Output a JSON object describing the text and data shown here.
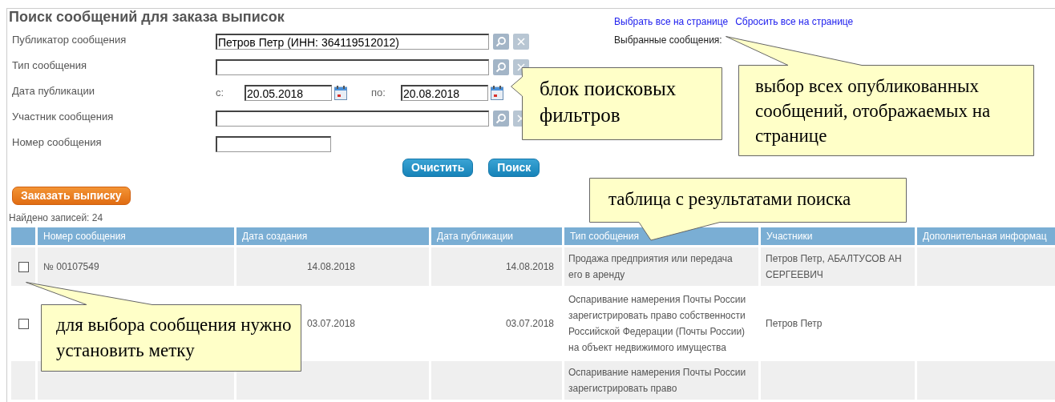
{
  "title": "Поиск сообщений для заказа выписок",
  "filters": [
    {
      "kind": "lookup",
      "label": "Публикатор сообщения",
      "value": "Петров Петр (ИНН: 364119512012)"
    },
    {
      "kind": "lookup",
      "label": "Тип сообщения"
    },
    {
      "kind": "daterange",
      "label": "Дата публикации",
      "from_label": "с:",
      "from": "20.05.2018",
      "to_label": "по:",
      "to": "20.08.2018"
    },
    {
      "kind": "lookup",
      "label": "Участник сообщения"
    },
    {
      "kind": "text",
      "label": "Номер сообщения"
    }
  ],
  "links": [
    "Выбрать все на странице",
    "Сбросить все на странице"
  ],
  "selected_label": "Выбранные сообщения:",
  "buttons": [
    "Очистить",
    "Поиск"
  ],
  "order_button": "Заказать выписку",
  "found": "Найдено записей: 24",
  "table": {
    "columns": [
      "Номер сообщения",
      "Дата создания",
      "Дата публикации",
      "Тип сообщения",
      "Участники",
      "Дополнительная информац"
    ],
    "rows": [
      {
        "checked": false,
        "number": "№ 00107549",
        "created": "14.08.2018",
        "published": "14.08.2018",
        "type": "Продажа предприятия или передача его в аренду",
        "participants": "Петров Петр, АБАЛТУСОВ АН СЕРГЕЕВИЧ"
      },
      {
        "checked": false,
        "created": "03.07.2018",
        "published": "03.07.2018",
        "type": "Оспаривание намерения Почты России зарегистрировать право собственности Российской Федерации (Почты России) на объект недвижимого имущества",
        "participants": "Петров Петр"
      },
      {
        "type": "Оспаривание намерения Почты России зарегистрировать право"
      }
    ]
  },
  "callouts": [
    {
      "kind": "left",
      "text": "блок поисковых фильтров"
    },
    {
      "kind": "up",
      "text": "выбор всех опубликованных сообщений, отображаемых на странице"
    },
    {
      "kind": "down",
      "text": "таблица с результатами поиска"
    },
    {
      "kind": "upleft",
      "text": "для выбора сообщения нужно установить метку"
    }
  ]
}
